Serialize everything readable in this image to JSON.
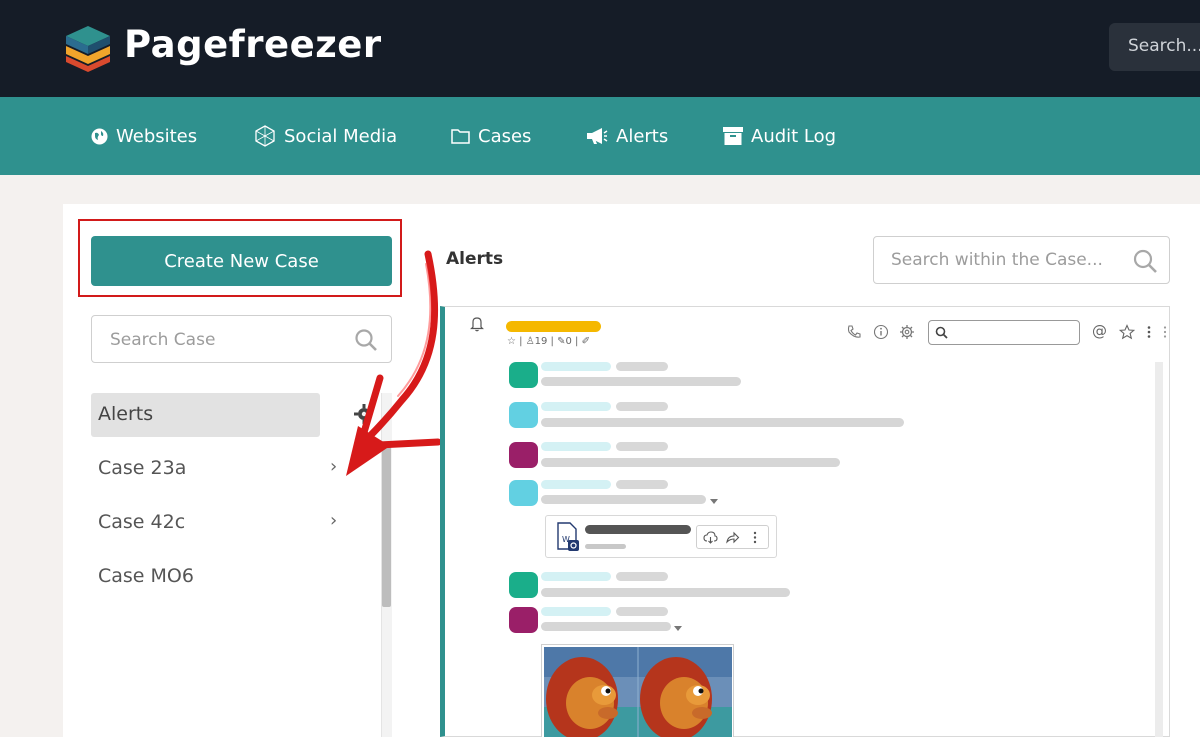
{
  "brand": {
    "name": "Pagefreezer"
  },
  "header": {
    "search_label": "Search..."
  },
  "nav": {
    "items": [
      {
        "label": "Websites",
        "icon": "globe-icon"
      },
      {
        "label": "Social Media",
        "icon": "network-icon"
      },
      {
        "label": "Cases",
        "icon": "folder-icon"
      },
      {
        "label": "Alerts",
        "icon": "megaphone-icon"
      },
      {
        "label": "Audit Log",
        "icon": "archive-box-icon"
      }
    ]
  },
  "sidebar": {
    "create_button": "Create New Case",
    "search_placeholder": "Search Case",
    "cases": [
      {
        "label": "Alerts",
        "active": true
      },
      {
        "label": "Case 23a",
        "has_children": true
      },
      {
        "label": "Case 42c",
        "has_children": true
      },
      {
        "label": "Case MO6",
        "has_children": false
      }
    ]
  },
  "main": {
    "title": "Alerts",
    "search_placeholder": "Search within the Case...",
    "channel": {
      "stats": "☆ | ♙19 | ✎0 | ✐"
    },
    "message_avatar_colors": [
      "#1aae8a",
      "#62d0e2",
      "#9a1f68",
      "#62d0e2",
      "#1aae8a",
      "#9a1f68"
    ]
  },
  "colors": {
    "topbar": "#151c27",
    "nav": "#2f918e",
    "accent": "#2f918e",
    "highlight_outline": "#d21a1a",
    "channel_tag": "#f5b800"
  }
}
